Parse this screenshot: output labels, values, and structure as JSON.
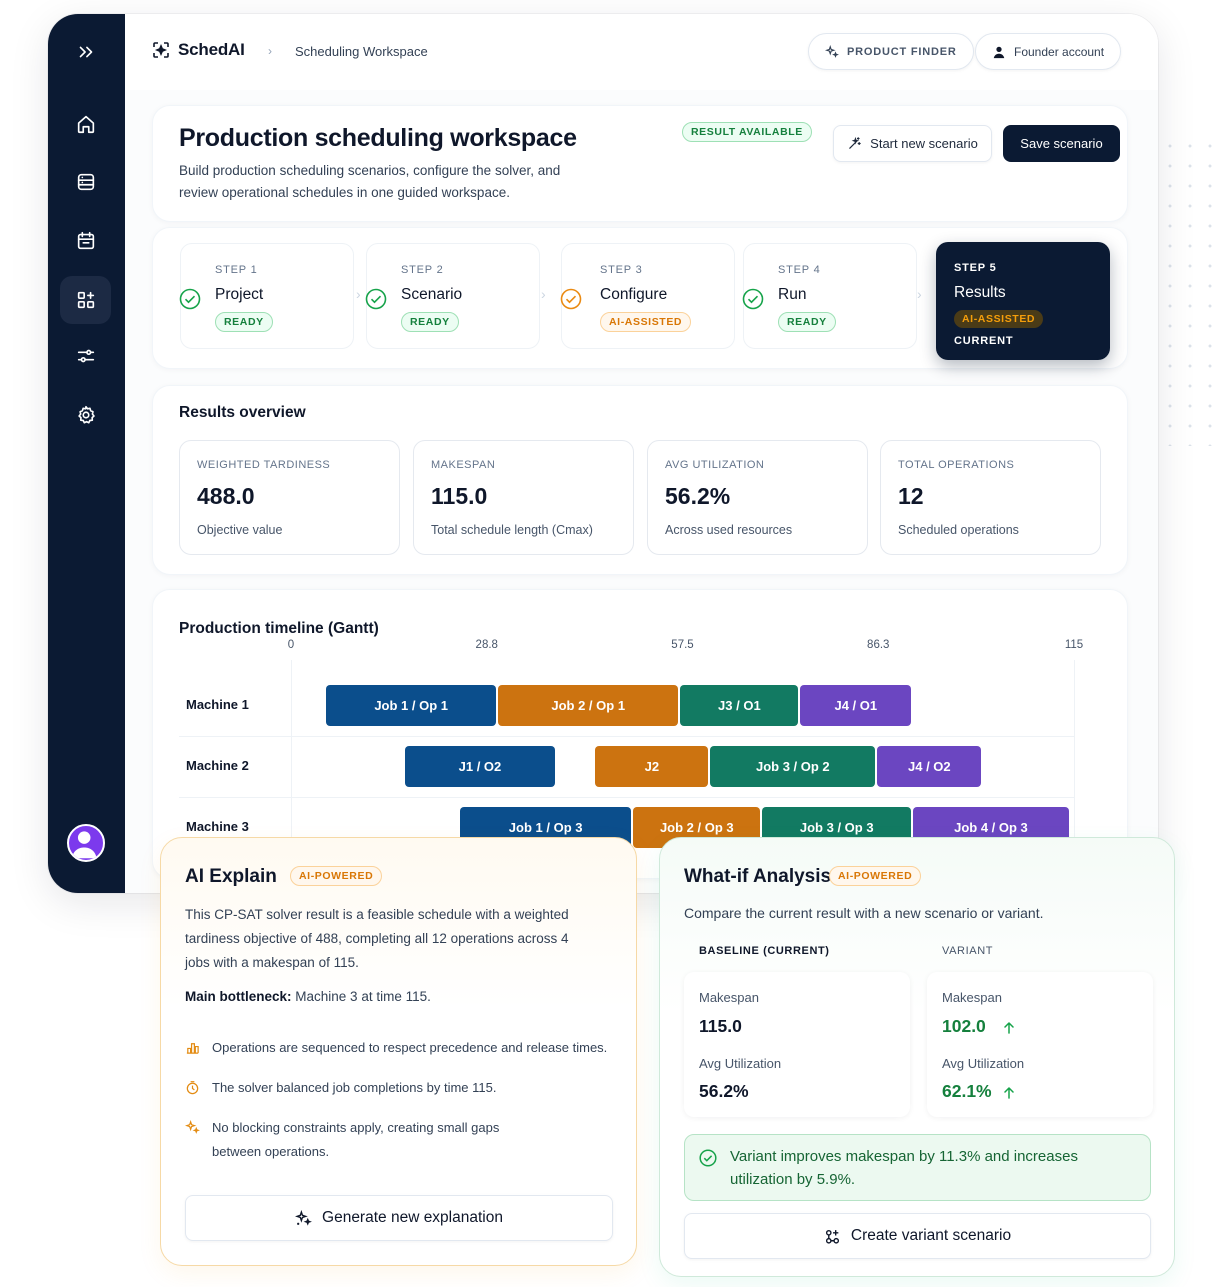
{
  "app": {
    "name": "SchedAI"
  },
  "breadcrumb": {
    "current": "Scheduling Workspace"
  },
  "topbar": {
    "product_finder": "PRODUCT FINDER",
    "account": "Founder account"
  },
  "sidebar": {
    "items": [
      {
        "icon": "chevrons-right-icon"
      },
      {
        "icon": "home-icon"
      },
      {
        "icon": "database-icon"
      },
      {
        "icon": "calendar-icon"
      },
      {
        "icon": "grid-plus-icon",
        "active": true
      },
      {
        "icon": "sliders-icon"
      },
      {
        "icon": "settings-icon"
      }
    ]
  },
  "header": {
    "title": "Production scheduling workspace",
    "subtitle": "Build production scheduling scenarios, configure the solver, and review operational schedules in one guided workspace.",
    "status_badge": "RESULT AVAILABLE",
    "start_button": "Start new scenario",
    "save_button": "Save scenario"
  },
  "steps": [
    {
      "num": "STEP 1",
      "name": "Project",
      "badge": "READY",
      "status": "done"
    },
    {
      "num": "STEP 2",
      "name": "Scenario",
      "badge": "READY",
      "status": "done"
    },
    {
      "num": "STEP 3",
      "name": "Configure",
      "badge": "AI-ASSISTED",
      "status": "ai"
    },
    {
      "num": "STEP 4",
      "name": "Run",
      "badge": "READY",
      "status": "done"
    },
    {
      "num": "STEP 5",
      "name": "Results",
      "badge": "AI-ASSISTED",
      "status": "current",
      "current_label": "CURRENT"
    }
  ],
  "overview": {
    "title": "Results overview",
    "metrics": [
      {
        "label": "WEIGHTED TARDINESS",
        "value": "488.0",
        "note": "Objective value"
      },
      {
        "label": "MAKESPAN",
        "value": "115.0",
        "note": "Total schedule length (Cmax)"
      },
      {
        "label": "AVG UTILIZATION",
        "value": "56.2%",
        "note": "Across used resources"
      },
      {
        "label": "TOTAL OPERATIONS",
        "value": "12",
        "note": "Scheduled operations"
      }
    ]
  },
  "gantt": {
    "title": "Production timeline (Gantt)",
    "ticks": [
      "0",
      "28.8",
      "57.5",
      "86.3",
      "115"
    ],
    "max": 115,
    "machines": [
      "Machine 1",
      "Machine 2",
      "Machine 3"
    ],
    "job_colors": {
      "1": "#0b4e8c",
      "2": "#cc7310",
      "3": "#127a62",
      "4": "#6b46c1"
    },
    "tasks": [
      {
        "machine": 0,
        "label": "Job 1 / Op 1",
        "job": "1",
        "start": 5.2,
        "end": 30.4
      },
      {
        "machine": 0,
        "label": "Job 2 / Op 1",
        "job": "2",
        "start": 30.4,
        "end": 57.2
      },
      {
        "machine": 0,
        "label": "J3 / O1",
        "job": "3",
        "start": 57.2,
        "end": 74.8
      },
      {
        "machine": 0,
        "label": "J4 / O1",
        "job": "4",
        "start": 74.8,
        "end": 91.4
      },
      {
        "machine": 1,
        "label": "J1 / O2",
        "job": "1",
        "start": 16.8,
        "end": 39.0
      },
      {
        "machine": 1,
        "label": "J2",
        "job": "2",
        "start": 44.7,
        "end": 61.6
      },
      {
        "machine": 1,
        "label": "Job 3 / Op 2",
        "job": "3",
        "start": 61.6,
        "end": 86.1
      },
      {
        "machine": 1,
        "label": "J4 / O2",
        "job": "4",
        "start": 86.1,
        "end": 101.7
      },
      {
        "machine": 2,
        "label": "Job 1 / Op 3",
        "job": "1",
        "start": 24.8,
        "end": 50.3
      },
      {
        "machine": 2,
        "label": "Job 2 / Op 3",
        "job": "2",
        "start": 50.3,
        "end": 69.2
      },
      {
        "machine": 2,
        "label": "Job 3 / Op 3",
        "job": "3",
        "start": 69.2,
        "end": 91.4
      },
      {
        "machine": 2,
        "label": "Job 4 / Op 3",
        "job": "4",
        "start": 91.4,
        "end": 114.5
      }
    ]
  },
  "explain": {
    "title": "AI Explain",
    "badge": "AI-POWERED",
    "body": "This CP-SAT solver result is a feasible schedule with a weighted tardiness objective of 488, completing all 12 operations across 4 jobs with a makespan of 115.",
    "bottleneck_label": "Main bottleneck:",
    "bottleneck_value": "Machine 3 at time 115.",
    "items": [
      "Operations are sequenced to respect precedence and release times.",
      "The solver balanced job completions by time 115.",
      "No blocking constraints apply, creating small gaps between operations."
    ],
    "button": "Generate new explanation"
  },
  "whatif": {
    "title": "What-if Analysis",
    "badge": "AI-POWERED",
    "subtitle": "Compare the current result with a new scenario or variant.",
    "baseline_label": "BASELINE (CURRENT)",
    "variant_label": "VARIANT",
    "baseline": {
      "makespan_label": "Makespan",
      "makespan": "115.0",
      "util_label": "Avg Utilization",
      "util": "56.2%"
    },
    "variant": {
      "makespan_label": "Makespan",
      "makespan": "102.0",
      "util_label": "Avg Utilization",
      "util": "62.1%"
    },
    "note": "Variant improves makespan by 11.3% and increases utilization by 5.9%.",
    "button": "Create variant scenario"
  },
  "colors": {
    "navy": "#0b1a33",
    "green": "#15803d",
    "orange": "#d97706"
  }
}
